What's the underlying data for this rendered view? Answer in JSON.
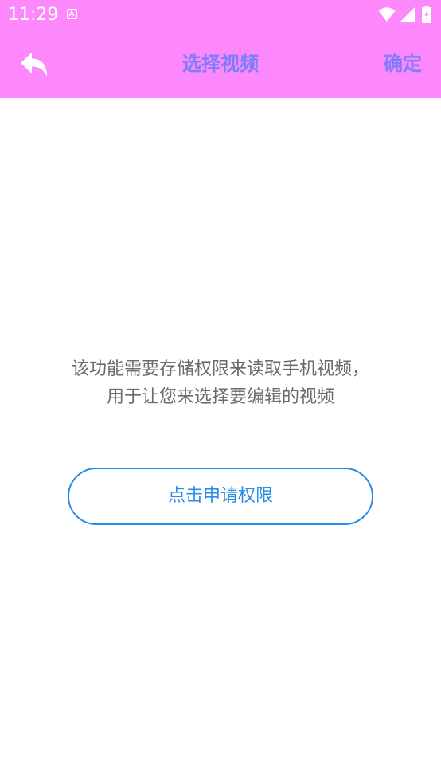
{
  "status_bar": {
    "time": "11:29",
    "icons": [
      "notification-a-icon",
      "wifi-icon",
      "signal-icon",
      "battery-charging-icon"
    ]
  },
  "toolbar": {
    "back_icon": "reply-arrow-icon",
    "title": "选择视频",
    "confirm_label": "确定"
  },
  "permission": {
    "message_line1": "该功能需要存储权限来读取手机视频，",
    "message_line2": "用于让您来选择要编辑的视频",
    "request_button_label": "点击申请权限"
  },
  "colors": {
    "header_background": "#fd88fb",
    "toolbar_text": "#7d7dfb",
    "message_text": "#6b6b6b",
    "button_accent": "#2a8ee8",
    "page_background": "#ffffff"
  }
}
